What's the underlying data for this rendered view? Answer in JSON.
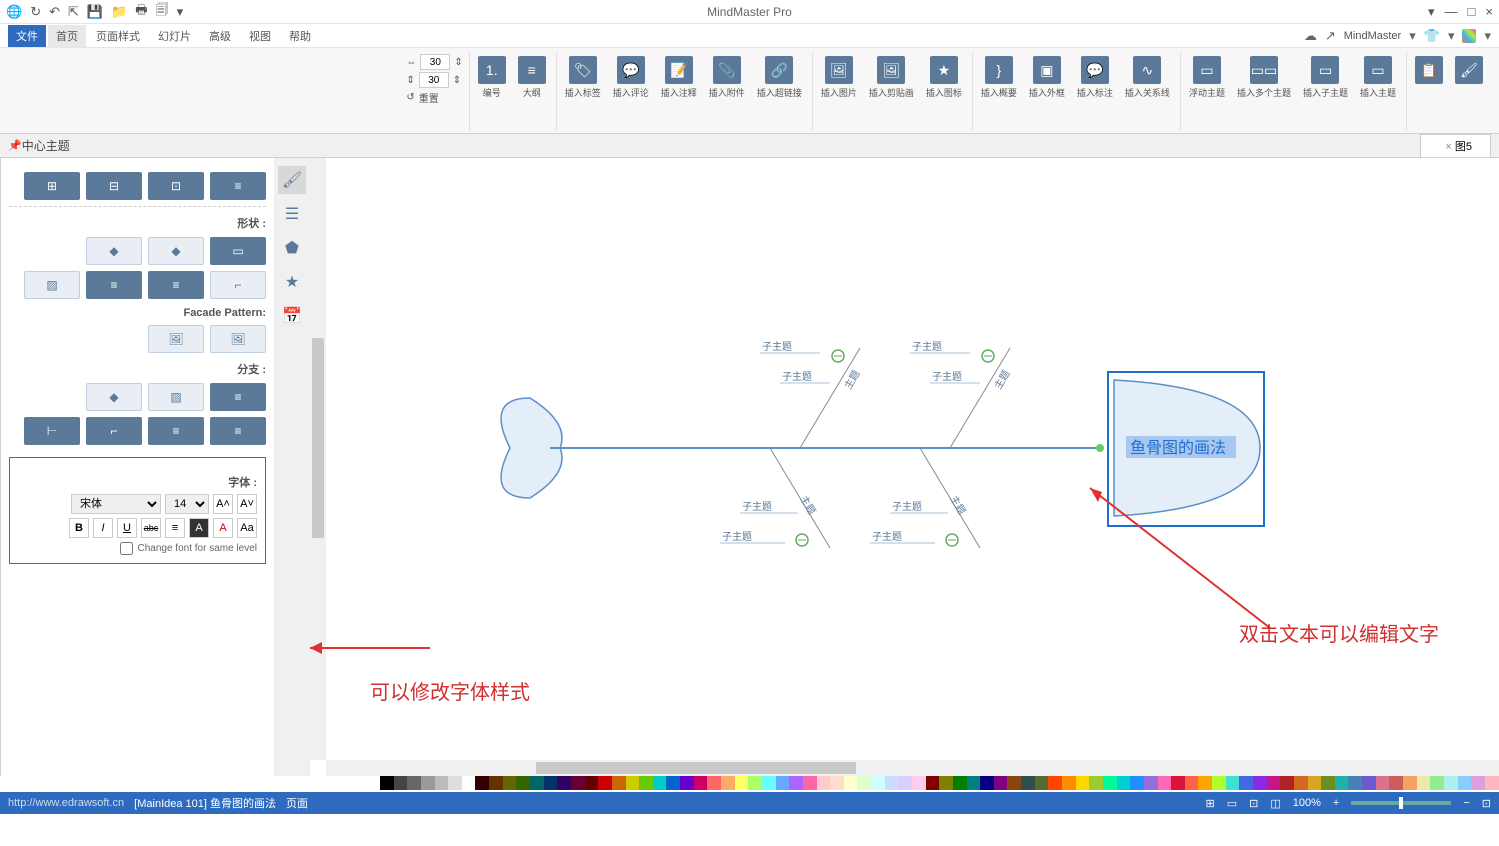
{
  "app_title": "MindMaster Pro",
  "window_controls": {
    "min": "—",
    "max": "□",
    "close": "×",
    "dropdown": "▾"
  },
  "titlebar_right_icons": [
    "⊕",
    "↶",
    "↷",
    "⎙",
    "💾",
    "📋",
    "🖶",
    "🗐",
    "▾"
  ],
  "quickbar": {
    "brand": "MindMaster",
    "tabs": [
      "文件",
      "首页",
      "页面样式",
      "幻灯片",
      "高级",
      "视图",
      "帮助"
    ],
    "active_tab": "文件",
    "current_tab": "首页"
  },
  "ribbon": {
    "groups": [
      {
        "items": [
          {
            "lbl": "",
            "g": "🖌"
          },
          {
            "lbl": "",
            "g": "📋"
          }
        ]
      },
      {
        "items": [
          {
            "lbl": "插入主题",
            "g": "▭"
          },
          {
            "lbl": "插入子主题",
            "g": "▭"
          },
          {
            "lbl": "插入多个主题",
            "g": "▭▭"
          },
          {
            "lbl": "浮动主题",
            "g": "▭"
          }
        ]
      },
      {
        "items": [
          {
            "lbl": "插入关系线",
            "g": "∿"
          },
          {
            "lbl": "插入标注",
            "g": "💬"
          },
          {
            "lbl": "插入外框",
            "g": "▣"
          },
          {
            "lbl": "插入概要",
            "g": "}"
          }
        ]
      },
      {
        "items": [
          {
            "lbl": "插入图标",
            "g": "★"
          },
          {
            "lbl": "插入剪贴画",
            "g": "🖼"
          },
          {
            "lbl": "插入图片",
            "g": "🖼"
          }
        ]
      },
      {
        "items": [
          {
            "lbl": "插入超链接",
            "g": "🔗"
          },
          {
            "lbl": "插入附件",
            "g": "📎"
          },
          {
            "lbl": "插入注释",
            "g": "📝"
          },
          {
            "lbl": "插入评论",
            "g": "💬"
          },
          {
            "lbl": "插入标签",
            "g": "🏷"
          }
        ]
      },
      {
        "items": [
          {
            "lbl": "大纲",
            "g": "≡"
          },
          {
            "lbl": "编号",
            "g": "1."
          }
        ]
      },
      {
        "label": "spacing",
        "spacing_h": "30",
        "spacing_v": "30",
        "reset": "重置"
      }
    ]
  },
  "doc_tab": {
    "name": "图5",
    "close": "×"
  },
  "side": {
    "title": "中心主题",
    "pin": "📌",
    "tabs": [
      "🖌",
      "☰",
      "✎",
      "★",
      "📅"
    ],
    "sections": {
      "shapes_lbl": "形状 :",
      "facade_lbl": "Facade Pattern:",
      "branch_lbl": "分支 :",
      "font_lbl": "字体 :"
    },
    "font": {
      "family": "宋体",
      "size": "14",
      "inc": "A˄",
      "dec": "A˅",
      "bold": "B",
      "italic": "I",
      "underline": "U",
      "strike": "abc",
      "chk_label": "Change font for same level"
    }
  },
  "fishbone": {
    "head_text": "鱼骨图的画法",
    "main_label": "主题",
    "sub_label": "子主题"
  },
  "annotations": {
    "right": "双击文本可以编辑文字",
    "left": "可以修改字体样式"
  },
  "status": {
    "url": "http://www.edrawsoft.cn",
    "doc": "[MainIdea 101]  鱼骨图的画法",
    "page_lbl": "页面",
    "zoom": "100%"
  }
}
